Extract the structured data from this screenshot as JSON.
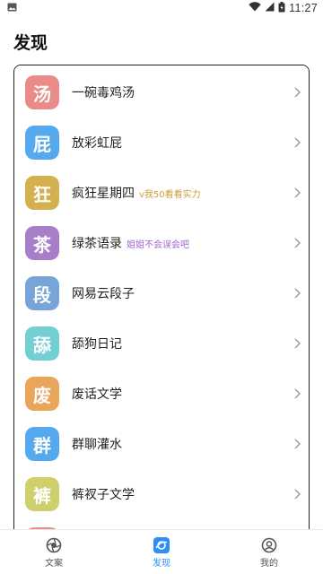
{
  "status_bar": {
    "time": "11:27"
  },
  "page": {
    "title": "发现"
  },
  "list": [
    {
      "icon_char": "汤",
      "icon_color": "#e98c89",
      "label": "一碗毒鸡汤",
      "tag": "",
      "tag_color": ""
    },
    {
      "icon_char": "屁",
      "icon_color": "#55a9ee",
      "label": "放彩虹屁",
      "tag": "",
      "tag_color": ""
    },
    {
      "icon_char": "狂",
      "icon_color": "#d2b14e",
      "label": "疯狂星期四",
      "tag": "v我50看看实力",
      "tag_color": "#c9a03a"
    },
    {
      "icon_char": "茶",
      "icon_color": "#a77fc8",
      "label": "绿茶语录",
      "tag": "姐姐不会误会吧",
      "tag_color": "#a463d4"
    },
    {
      "icon_char": "段",
      "icon_color": "#77a5d8",
      "label": "网易云段子",
      "tag": "",
      "tag_color": ""
    },
    {
      "icon_char": "舔",
      "icon_color": "#72cfd4",
      "label": "舔狗日记",
      "tag": "",
      "tag_color": ""
    },
    {
      "icon_char": "废",
      "icon_color": "#e9a55a",
      "label": "废话文学",
      "tag": "",
      "tag_color": ""
    },
    {
      "icon_char": "群",
      "icon_color": "#55a9ee",
      "label": "群聊灌水",
      "tag": "",
      "tag_color": ""
    },
    {
      "icon_char": "裤",
      "icon_color": "#cfd06c",
      "label": "裤衩子文学",
      "tag": "",
      "tag_color": ""
    }
  ],
  "partial_item_color": "#e98c89",
  "tabs": [
    {
      "label": "文案",
      "icon": "copywriting-icon",
      "active": false
    },
    {
      "label": "发现",
      "icon": "discover-icon",
      "active": true
    },
    {
      "label": "我的",
      "icon": "profile-icon",
      "active": false
    }
  ],
  "colors": {
    "accent": "#2f8ef5"
  }
}
